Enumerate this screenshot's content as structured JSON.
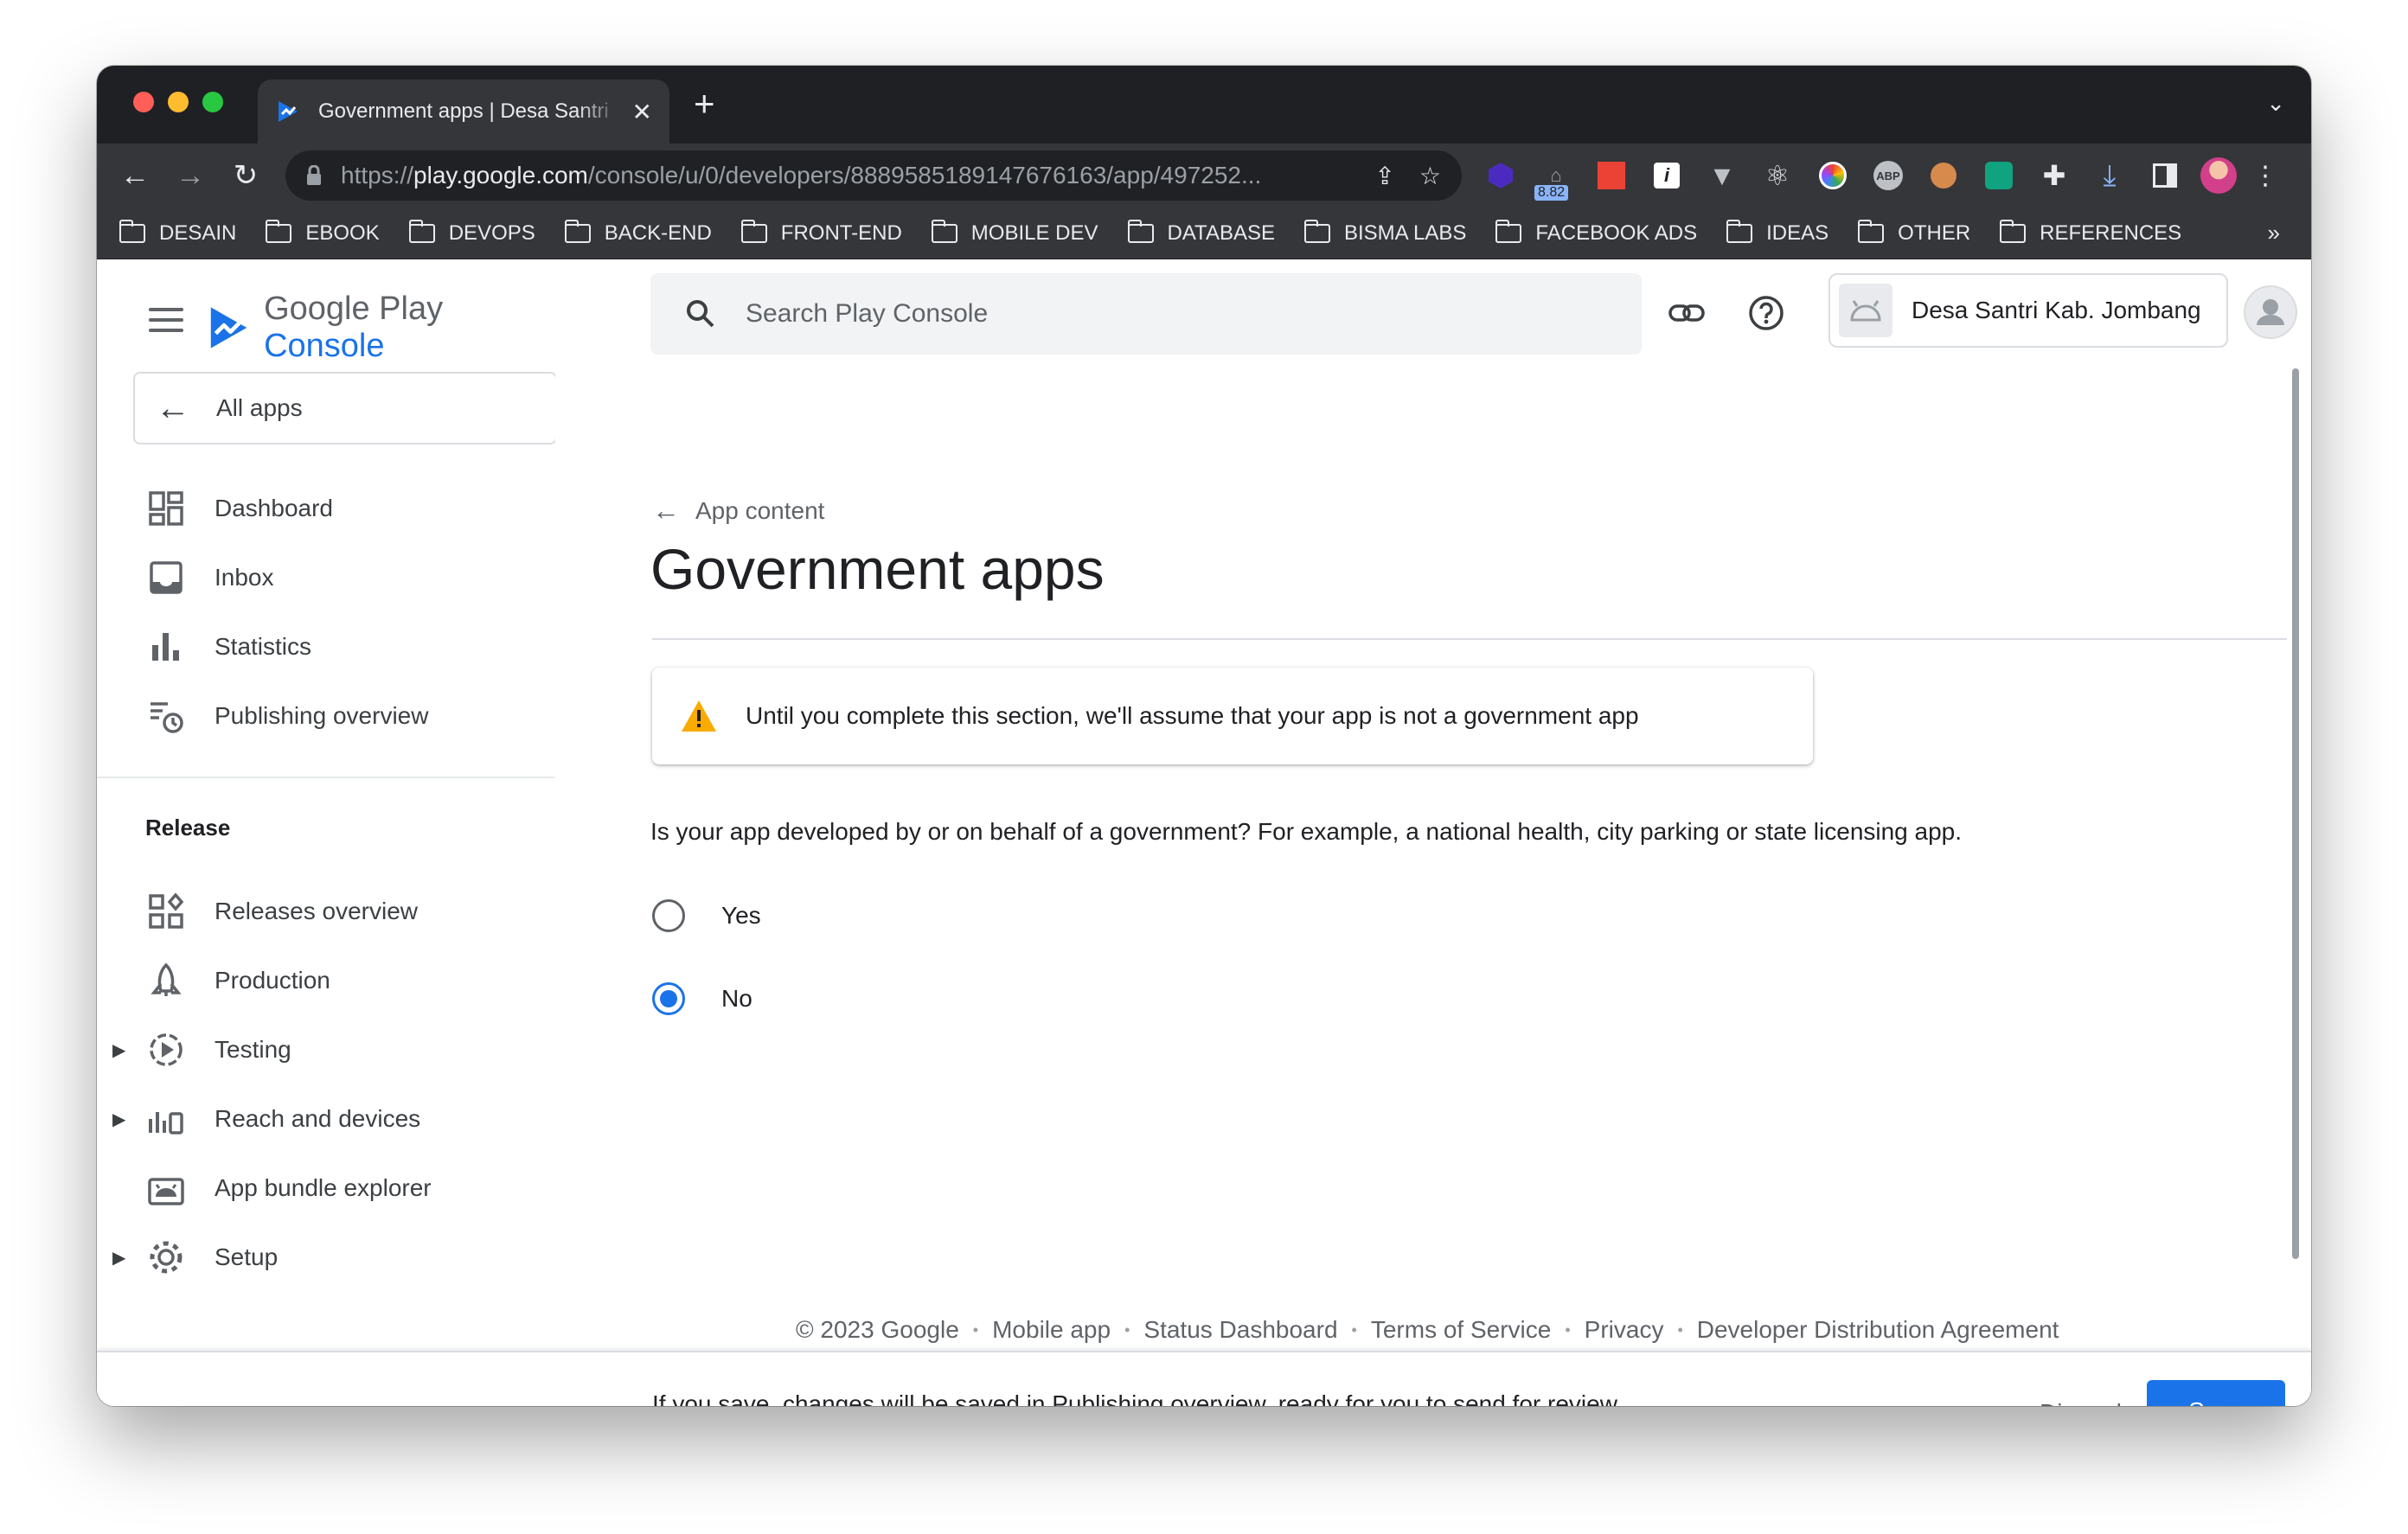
{
  "browser": {
    "tab_title": "Government apps | Desa Santri",
    "tab_close": "✕",
    "new_tab": "+",
    "tab_menu": "⌄",
    "url_prefix": "https://",
    "url_host": "play.google.com",
    "url_path": "/console/u/0/developers/8889585189147676163/app/497252...",
    "extension_badge": "8.82",
    "bookmarks": [
      "DESAIN",
      "EBOOK",
      "DEVOPS",
      "BACK-END",
      "FRONT-END",
      "MOBILE DEV",
      "DATABASE",
      "BISMA LABS",
      "FACEBOOK ADS",
      "IDEAS",
      "OTHER",
      "REFERENCES"
    ],
    "bookmarks_more": "»"
  },
  "brand": {
    "google_play": "Google Play",
    "console": "Console",
    "accent": "#1a73e8"
  },
  "sidebar": {
    "all_apps": "All apps",
    "items": [
      {
        "label": "Dashboard",
        "icon": "dashboard-icon"
      },
      {
        "label": "Inbox",
        "icon": "inbox-icon"
      },
      {
        "label": "Statistics",
        "icon": "statistics-icon"
      },
      {
        "label": "Publishing overview",
        "icon": "publishing-overview-icon"
      }
    ],
    "release_title": "Release",
    "release_items": [
      {
        "label": "Releases overview",
        "icon": "releases-overview-icon"
      },
      {
        "label": "Production",
        "icon": "production-icon"
      },
      {
        "label": "Testing",
        "icon": "testing-icon"
      },
      {
        "label": "Reach and devices",
        "icon": "reach-devices-icon"
      },
      {
        "label": "App bundle explorer",
        "icon": "app-bundle-icon"
      },
      {
        "label": "Setup",
        "icon": "setup-icon"
      }
    ]
  },
  "header": {
    "search_placeholder": "Search Play Console",
    "developer_name": "Desa Santri Kab. Jombang"
  },
  "main": {
    "breadcrumb": "App content",
    "title": "Government apps",
    "notice": "Until you complete this section, we'll assume that your app is not a government app",
    "question": "Is your app developed by or on behalf of a government? For example, a national health, city parking or state licensing app.",
    "options": [
      {
        "label": "Yes",
        "selected": false
      },
      {
        "label": "No",
        "selected": true
      }
    ]
  },
  "footer": {
    "links": [
      "© 2023 Google",
      "Mobile app",
      "Status Dashboard",
      "Terms of Service",
      "Privacy",
      "Developer Distribution Agreement"
    ]
  },
  "savebar": {
    "message": "If you save, changes will be saved in Publishing overview, ready for you to send for review.",
    "discard": "Discard",
    "save": "Save"
  }
}
